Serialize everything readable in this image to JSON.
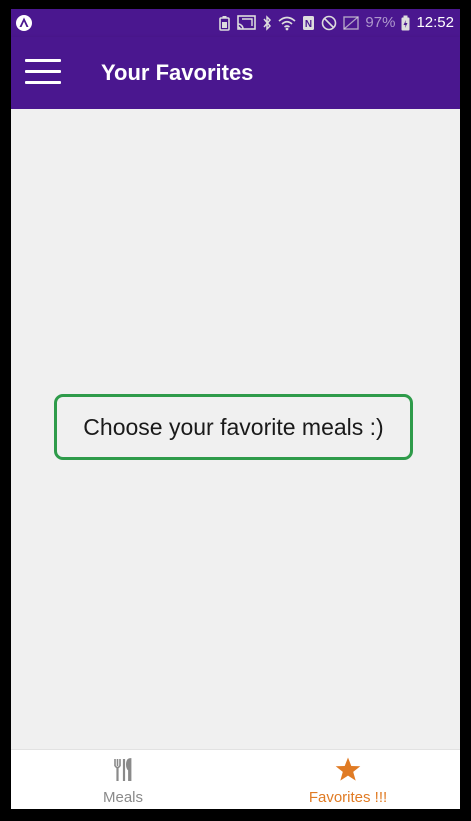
{
  "status_bar": {
    "battery_percent": "97%",
    "time": "12:52",
    "icons": [
      "app-notification-icon",
      "battery-saver-icon",
      "cast-icon",
      "bluetooth-icon",
      "wifi-icon",
      "nfc-icon",
      "do-not-disturb-icon",
      "vibrate-icon",
      "battery-charging-icon"
    ]
  },
  "app_bar": {
    "title": "Your Favorites",
    "menu_icon": "hamburger-menu-icon"
  },
  "content": {
    "empty_message": "Choose your favorite meals :)"
  },
  "bottom_nav": {
    "tabs": [
      {
        "label": "Meals",
        "icon": "cutlery-icon",
        "active": false
      },
      {
        "label": "Favorites !!!",
        "icon": "star-icon",
        "active": true
      }
    ]
  },
  "colors": {
    "primary": "#4a178f",
    "accent": "#e07b24",
    "inactive": "#8a8a8a",
    "message_border": "#2e9b4a",
    "background": "#f0f0f0"
  }
}
